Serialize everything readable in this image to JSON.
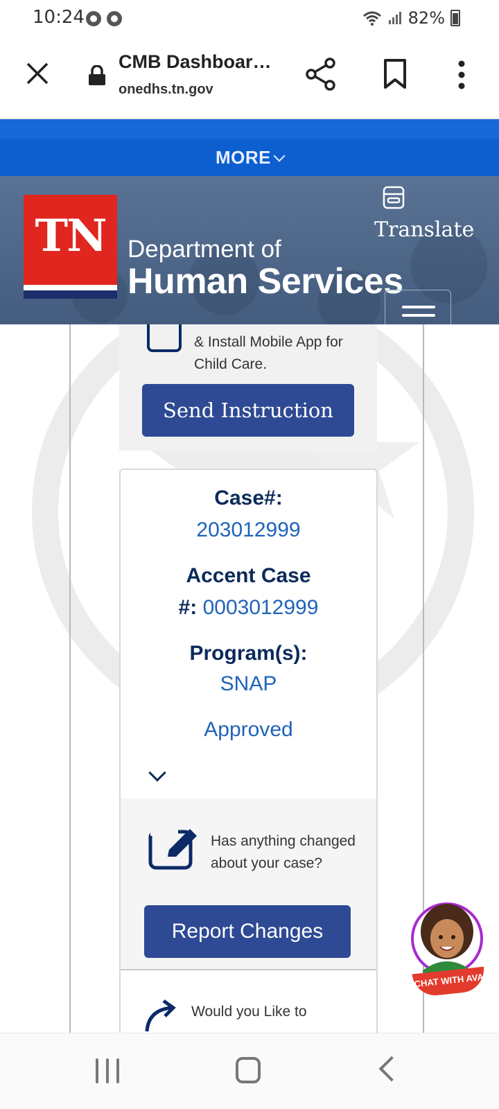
{
  "status_bar": {
    "time": "10:24",
    "battery": "82%",
    "icons": [
      "chrome-icon",
      "chrome-icon",
      "wifi-icon",
      "signal-icon",
      "battery-icon"
    ]
  },
  "browser": {
    "page_title": "CMB Dashboar…",
    "domain": "onedhs.tn.gov",
    "icons": [
      "close-icon",
      "lock-icon",
      "share-icon",
      "bookmark-icon",
      "more-vert-icon"
    ]
  },
  "nav": {
    "more_label": "MORE"
  },
  "header": {
    "logo_text": "TN",
    "dept_line1": "Department of",
    "dept_line2": "Human Services",
    "translate_label": "Translate"
  },
  "instruction_panel": {
    "text": "& Install Mobile App for Child Care.",
    "button_label": "Send Instruction"
  },
  "case_card": {
    "case_label": "Case#:",
    "case_number": "203012999",
    "accent_label_line1": "Accent Case",
    "accent_label_line2": "#:",
    "accent_number": "0003012999",
    "program_label": "Program(s):",
    "program_value": "SNAP",
    "status": "Approved"
  },
  "changes_panel": {
    "question": "Has anything changed about your case?",
    "button_label": "Report Changes"
  },
  "next_section": {
    "text": "Would you Like to"
  },
  "chat": {
    "label": "CHAT WITH AVA"
  },
  "colors": {
    "brand_blue": "#0d5fd0",
    "button_blue": "#2e4a94",
    "tn_red": "#e0261f",
    "link_blue": "#1f63b8",
    "heading_navy": "#0b2a5a"
  }
}
